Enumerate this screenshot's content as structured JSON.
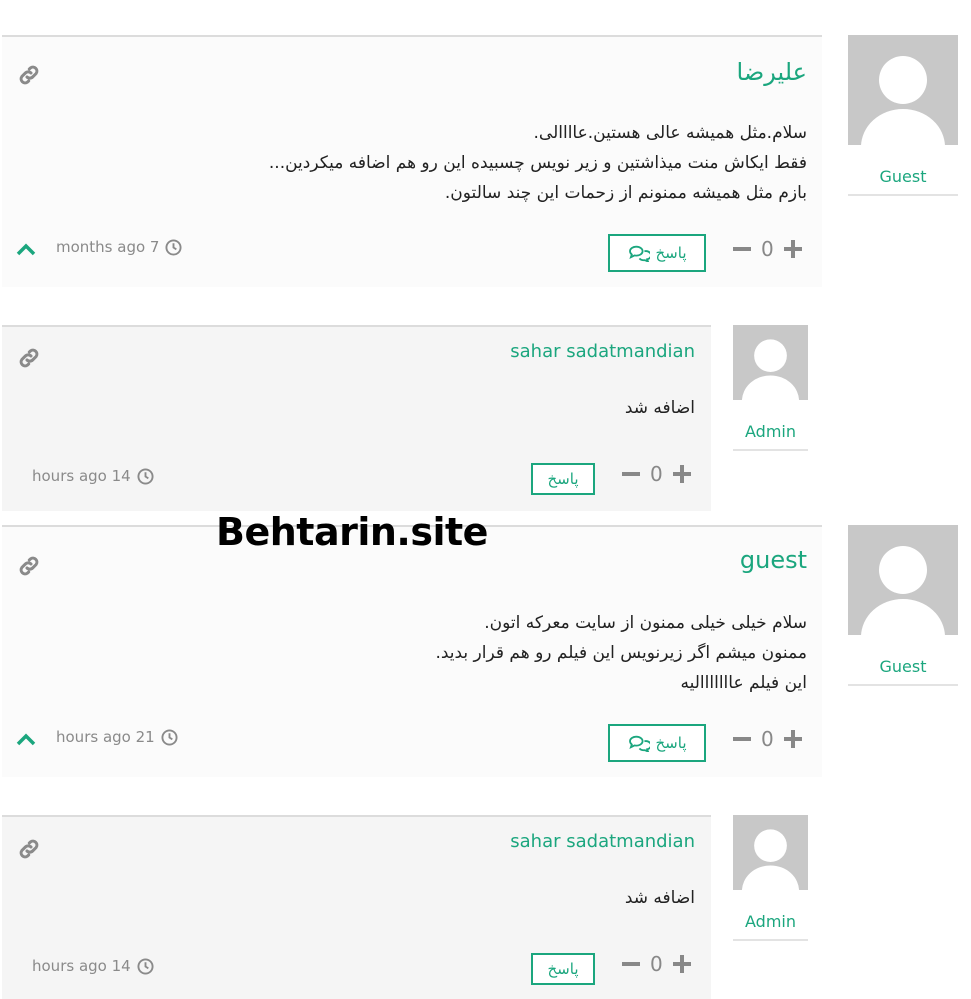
{
  "colors": {
    "accent": "#1ba67e",
    "avatar_bg": "#c8c8c8",
    "muted": "#888888"
  },
  "watermark": "Behtarin.site",
  "comments": [
    {
      "author": "علیرضا",
      "role": "Guest",
      "lines": [
        "سلام.مثل همیشه عالی هستین.عاااالی.",
        "فقط ایکاش منت میذاشتین و زیر نویس چسبیده این رو هم اضافه میکردین...",
        "بازم مثل همیشه ممنونم از زحمات این چند سالتون."
      ],
      "reply_label": "پاسخ",
      "votes": "0",
      "time": "months ago 7"
    },
    {
      "author": "sahar sadatmandian",
      "role": "Admin",
      "lines": [
        "اضافه شد"
      ],
      "reply_label": "پاسخ",
      "votes": "0",
      "time": "hours ago 14"
    },
    {
      "author": "guest",
      "role": "Guest",
      "lines": [
        "سلام خیلی خیلی ممنون از سایت معرکه اتون.",
        "ممنون میشم اگر زیرنویس این فیلم رو هم قرار بدید.",
        "این فیلم عااااااالیه"
      ],
      "reply_label": "پاسخ",
      "votes": "0",
      "time": "hours ago 21"
    },
    {
      "author": "sahar sadatmandian",
      "role": "Admin",
      "lines": [
        "اضافه شد"
      ],
      "reply_label": "پاسخ",
      "votes": "0",
      "time": "hours ago 14"
    }
  ]
}
